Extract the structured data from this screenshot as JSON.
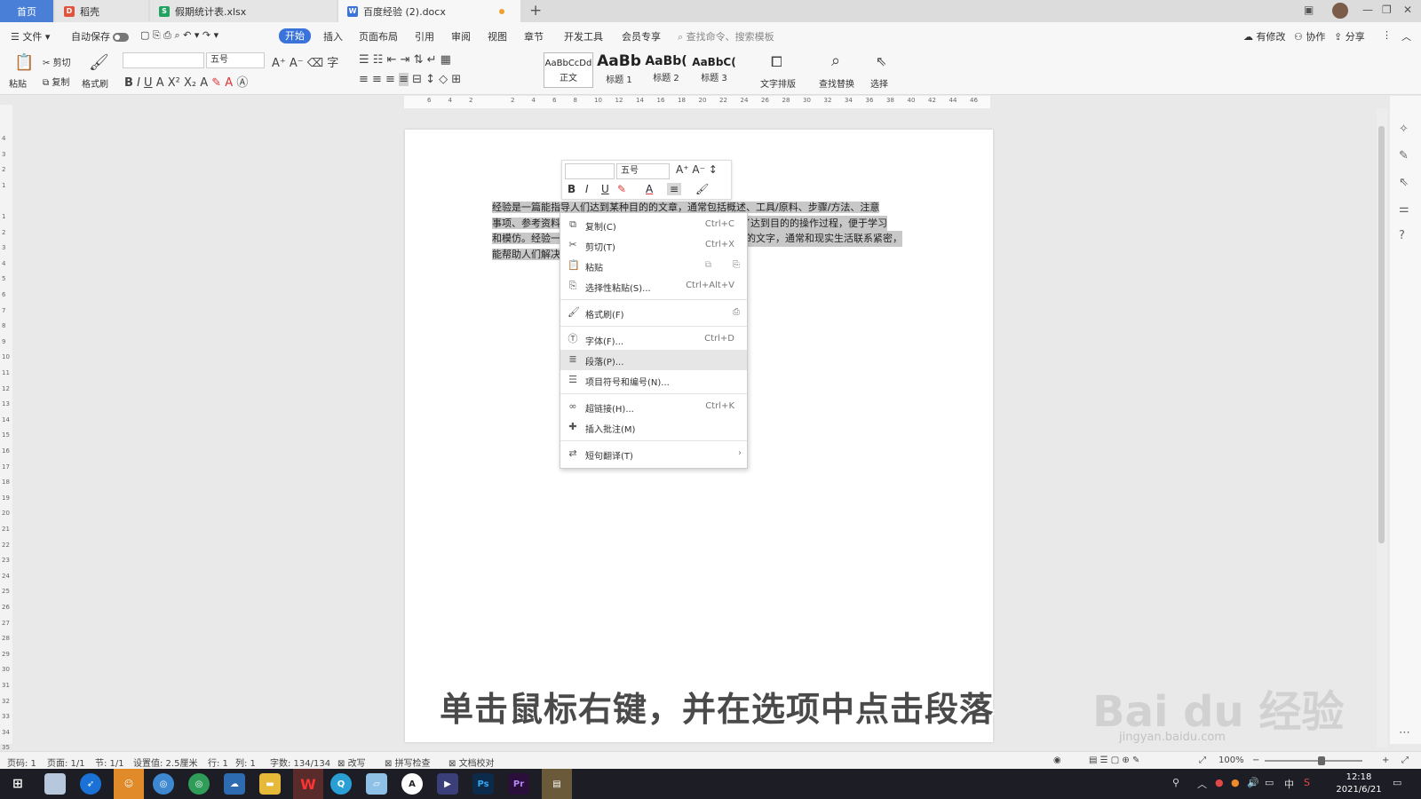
{
  "tabs": {
    "home": "首页",
    "docer": "稻壳",
    "xlsx": "假期统计表.xlsx",
    "docx": "百度经验 (2).docx",
    "new_tab_glyph": "+"
  },
  "menu": {
    "file": "文件",
    "autosave": "自动保存",
    "items": [
      "开始",
      "插入",
      "页面布局",
      "引用",
      "审阅",
      "视图",
      "章节",
      "开发工具",
      "会员专享"
    ],
    "search_placeholder": "查找命令、搜索模板",
    "right": [
      "有修改",
      "协作",
      "分享"
    ]
  },
  "ribbon": {
    "paste": "粘贴",
    "cut": "剪切",
    "copy": "复制",
    "format_painter": "格式刷",
    "font_size": "五号",
    "styles": [
      {
        "sample": "AaBbCcDd",
        "label": "正文"
      },
      {
        "sample": "AaBb",
        "label": "标题 1"
      },
      {
        "sample": "AaBb(",
        "label": "标题 2"
      },
      {
        "sample": "AaBbC(",
        "label": "标题 3"
      }
    ],
    "text_layout": "文字排版",
    "find_replace": "查找替换",
    "select": "选择"
  },
  "ruler": {
    "h_ticks": [
      "6",
      "4",
      "2",
      "",
      "2",
      "4",
      "6",
      "8",
      "10",
      "12",
      "14",
      "16",
      "18",
      "20",
      "22",
      "24",
      "26",
      "28",
      "30",
      "32",
      "34",
      "36",
      "38",
      "40",
      "42",
      "44",
      "46"
    ],
    "v_ticks": [
      "4",
      "3",
      "2",
      "1",
      "",
      "1",
      "2",
      "3",
      "4",
      "5",
      "6",
      "7",
      "8",
      "9",
      "10",
      "11",
      "12",
      "13",
      "14",
      "15",
      "16",
      "17",
      "18",
      "19",
      "20",
      "21",
      "22",
      "23",
      "24",
      "25",
      "26",
      "27",
      "28",
      "29",
      "30",
      "31",
      "32",
      "33",
      "34",
      "35"
    ]
  },
  "document": {
    "lines": [
      "经验是一篇能指导人们达到某种目的的文章，通常包括概述、工具/原料、步骤/方法、注意",
      "事项、参考资料",
      "和模仿。经验一",
      "能帮助人们解决"
    ],
    "line2_right": "了达到目的的操作过程，便于学习",
    "line3_right": "的文字，通常和现实生活联系紧密，"
  },
  "minibar": {
    "font_size": "五号"
  },
  "context_menu": {
    "items": [
      {
        "label": "复制(C)",
        "shortcut": "Ctrl+C",
        "icon": "copy-icon"
      },
      {
        "label": "剪切(T)",
        "shortcut": "Ctrl+X",
        "icon": "scissors-icon"
      },
      {
        "label": "粘贴",
        "shortcut": "",
        "icon": "paste-icon"
      },
      {
        "label": "选择性粘贴(S)...",
        "shortcut": "Ctrl+Alt+V",
        "icon": "paste-special-icon"
      },
      {
        "label": "格式刷(F)",
        "shortcut": "",
        "icon": "format-painter-icon"
      },
      {
        "label": "字体(F)...",
        "shortcut": "Ctrl+D",
        "icon": "font-icon"
      },
      {
        "label": "段落(P)...",
        "shortcut": "",
        "icon": "paragraph-icon"
      },
      {
        "label": "项目符号和编号(N)...",
        "shortcut": "",
        "icon": "list-icon"
      },
      {
        "label": "超链接(H)...",
        "shortcut": "Ctrl+K",
        "icon": "link-icon"
      },
      {
        "label": "插入批注(M)",
        "shortcut": "",
        "icon": "comment-icon"
      },
      {
        "label": "短句翻译(T)",
        "shortcut": "",
        "icon": "translate-icon"
      }
    ],
    "highlighted_index": 6
  },
  "caption": "单击鼠标右键，并在选项中点击段落",
  "watermark": {
    "main": "Bai du 经验",
    "url": "jingyan.baidu.com"
  },
  "statusbar": {
    "page_no": "页码: 1",
    "pages": "页面: 1/1",
    "section": "节: 1/1",
    "setting": "设置值: 2.5厘米",
    "row": "行: 1",
    "col": "列: 1",
    "words": "字数: 134/134",
    "revise": "改写",
    "spell": "拼写检查",
    "proof": "文档校对",
    "zoom": "100%"
  },
  "taskbar": {
    "time": "12:18",
    "date": "2021/6/21",
    "ime": "中"
  },
  "colors": {
    "accent": "#3a73d9",
    "page_bg": "#e9e9e9",
    "selection": "#c8c8c8",
    "taskbar": "#1d1d25"
  }
}
